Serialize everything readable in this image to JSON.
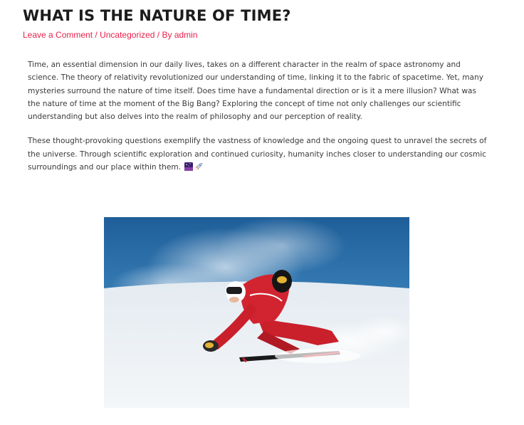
{
  "post": {
    "title": "WHAT IS THE NATURE OF TIME?",
    "meta": {
      "comment_link": "Leave a Comment",
      "separator_1": " / ",
      "category_link": "Uncategorized",
      "separator_2": " / By ",
      "author_link": "admin"
    },
    "paragraphs": [
      "Time, an essential dimension in our daily lives, takes on a different character in the realm of space astronomy and science. The theory of relativity revolutionized our understanding of time, linking it to the fabric of spacetime. Yet, many mysteries surround the nature of time itself. Does time have a fundamental direction or is it a mere illusion? What was the nature of time at the moment of the Big Bang? Exploring the concept of time not only challenges our scientific understanding but also delves into the realm of philosophy and our perception of reality.",
      "These thought-provoking questions exemplify the vastness of knowledge and the ongoing quest to unravel the secrets of the universe. Through scientific exploration and continued curiosity, humanity inches closer to understanding our cosmic surroundings and our place within them."
    ],
    "emoji_icons": [
      "night-sky-icon",
      "rocket-icon"
    ],
    "image": {
      "subject": "skier-photo"
    }
  },
  "colors": {
    "title": "#1c1c1c",
    "meta_link": "#e8214b",
    "body_text": "#3a3a3a"
  }
}
